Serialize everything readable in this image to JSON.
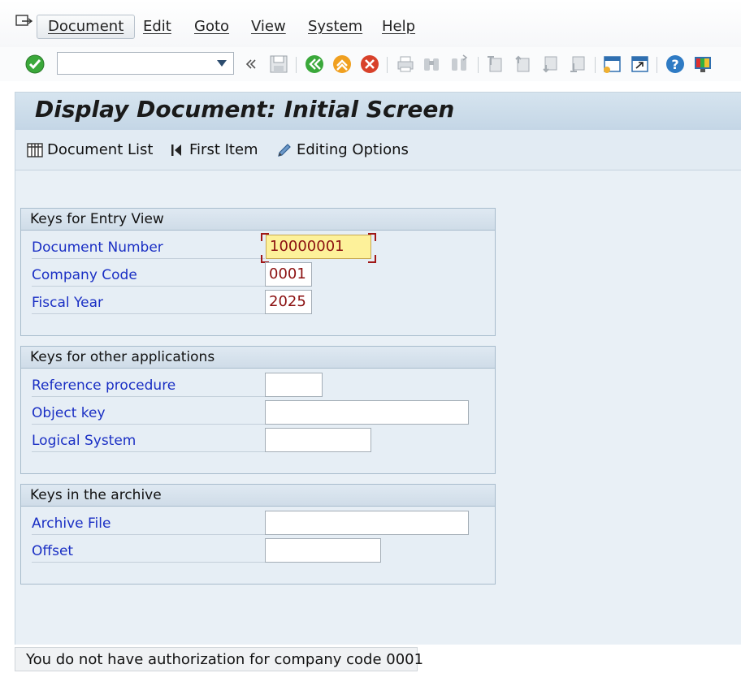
{
  "menu": {
    "items": [
      {
        "label": "Document",
        "active": true
      },
      {
        "label": "Edit"
      },
      {
        "label": "Goto"
      },
      {
        "label": "View"
      },
      {
        "label": "System"
      },
      {
        "label": "Help"
      }
    ]
  },
  "toolbar": {
    "command_field_value": ""
  },
  "screen": {
    "title": "Display Document: Initial Screen",
    "app_toolbar": {
      "document_list": "Document List",
      "first_item": "First Item",
      "editing_options": "Editing Options"
    }
  },
  "groups": {
    "entry_view": {
      "header": "Keys for Entry View",
      "document_number_label": "Document Number",
      "document_number_value": "10000001",
      "company_code_label": "Company Code",
      "company_code_value": "0001",
      "fiscal_year_label": "Fiscal Year",
      "fiscal_year_value": "2025"
    },
    "other_apps": {
      "header": "Keys for other applications",
      "reference_procedure_label": "Reference procedure",
      "reference_procedure_value": "",
      "object_key_label": "Object key",
      "object_key_value": "",
      "logical_system_label": "Logical System",
      "logical_system_value": ""
    },
    "archive": {
      "header": "Keys in the archive",
      "archive_file_label": "Archive File",
      "archive_file_value": "",
      "offset_label": "Offset",
      "offset_value": ""
    }
  },
  "status": {
    "message": "You do not have authorization for company code 0001",
    "type": "error"
  },
  "colors": {
    "label_blue": "#1a2fc4",
    "value_red": "#8b1010",
    "focus_yellow": "#fdf19a"
  }
}
